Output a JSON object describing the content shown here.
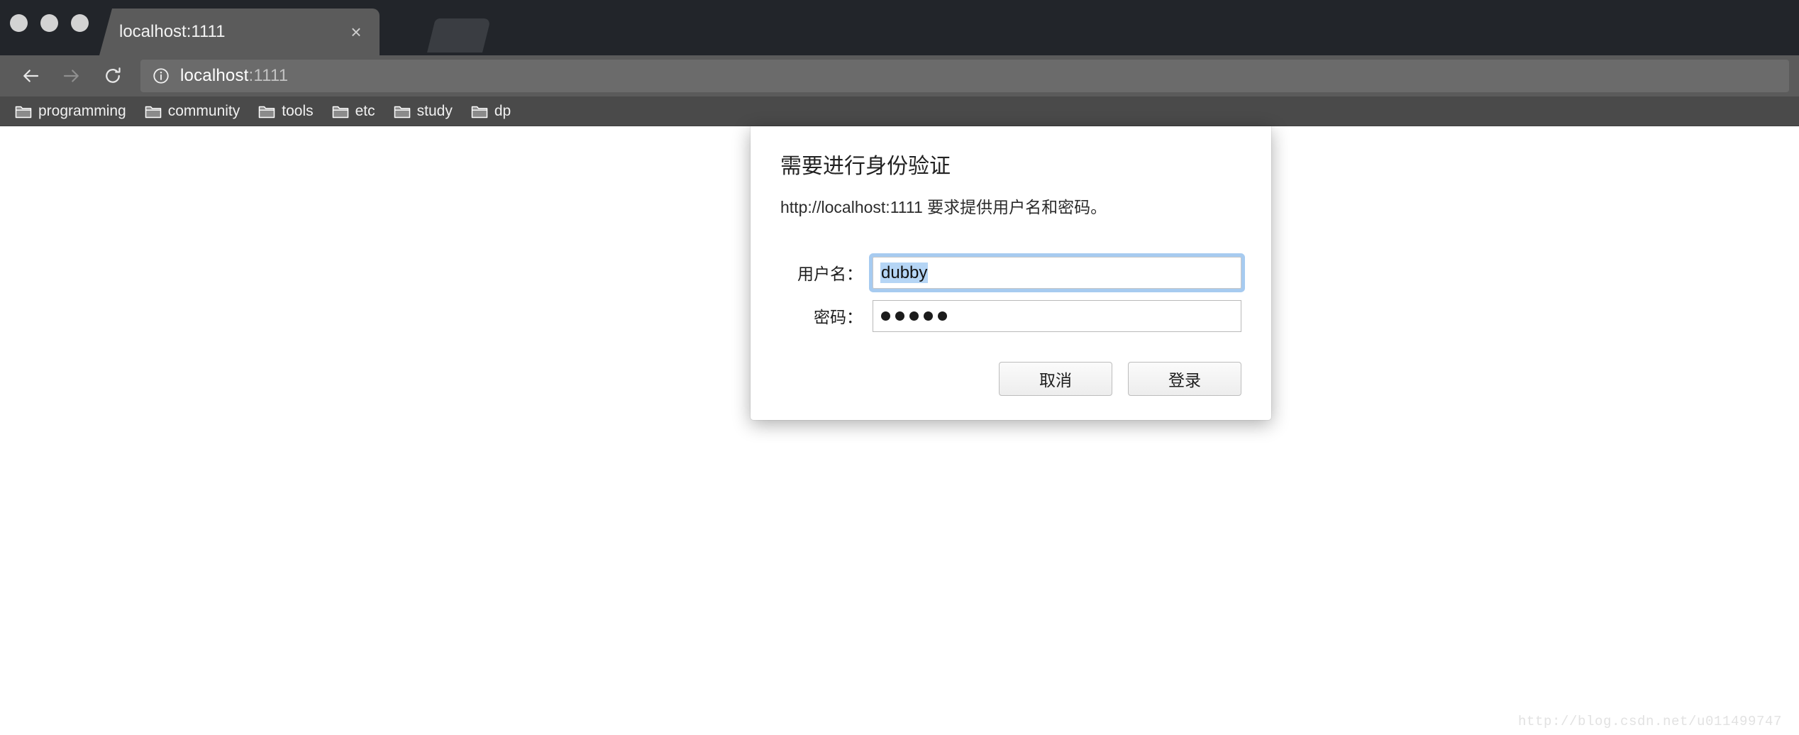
{
  "window": {
    "traffic_lights": [
      "close",
      "minimize",
      "maximize"
    ]
  },
  "tabs": [
    {
      "title": "localhost:1111",
      "close_label": "×",
      "active": true
    }
  ],
  "newtab": {
    "label": "new-tab"
  },
  "toolbar": {
    "back_label": "Back",
    "forward_label": "Forward",
    "reload_label": "Reload",
    "url_host": "localhost",
    "url_port": ":1111",
    "site_info_icon": "info-circle-icon"
  },
  "bookmarks": {
    "items": [
      {
        "label": "programming",
        "icon": "folder-icon"
      },
      {
        "label": "community",
        "icon": "folder-icon"
      },
      {
        "label": "tools",
        "icon": "folder-icon"
      },
      {
        "label": "etc",
        "icon": "folder-icon"
      },
      {
        "label": "study",
        "icon": "folder-icon"
      },
      {
        "label": "dp",
        "icon": "folder-icon"
      }
    ]
  },
  "dialog": {
    "title": "需要进行身份验证",
    "message": "http://localhost:1111 要求提供用户名和密码。",
    "username": {
      "label": "用户名：",
      "value": "dubby",
      "placeholder": "",
      "focused": true,
      "selected": true
    },
    "password": {
      "label": "密码：",
      "masked_length": 5,
      "mask_char": "●",
      "placeholder": ""
    },
    "buttons": {
      "cancel": "取消",
      "login": "登录"
    }
  },
  "watermark": {
    "text": "http://blog.csdn.net/u011499747"
  },
  "colors": {
    "tabstrip_bg": "#22252a",
    "toolbar_bg": "#5b5b5b",
    "bookmarks_bg": "#4a4a4a",
    "urlbar_bg": "#6b6b6b",
    "page_bg": "#ffffff",
    "focus_ring": "#a7cbf0",
    "selection": "#b5d5f5"
  }
}
